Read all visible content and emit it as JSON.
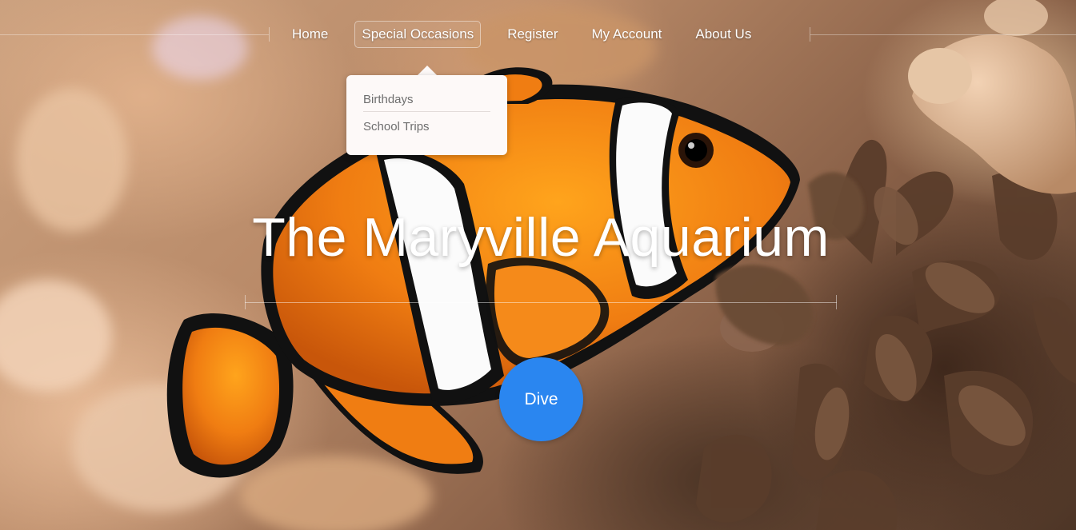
{
  "nav": {
    "items": [
      {
        "label": "Home"
      },
      {
        "label": "Special Occasions"
      },
      {
        "label": "Register"
      },
      {
        "label": "My Account"
      },
      {
        "label": "About Us"
      }
    ],
    "active_index": 1
  },
  "dropdown": {
    "items": [
      {
        "label": "Birthdays"
      },
      {
        "label": "School Trips"
      }
    ]
  },
  "hero": {
    "title": "The Maryville Aquarium",
    "button_label": "Dive"
  },
  "colors": {
    "accent": "#2a86f0",
    "dropdown_bg": "#fdf9f8",
    "clownfish_orange": "#f07d12"
  },
  "background": {
    "image": "clownfish-photo"
  }
}
